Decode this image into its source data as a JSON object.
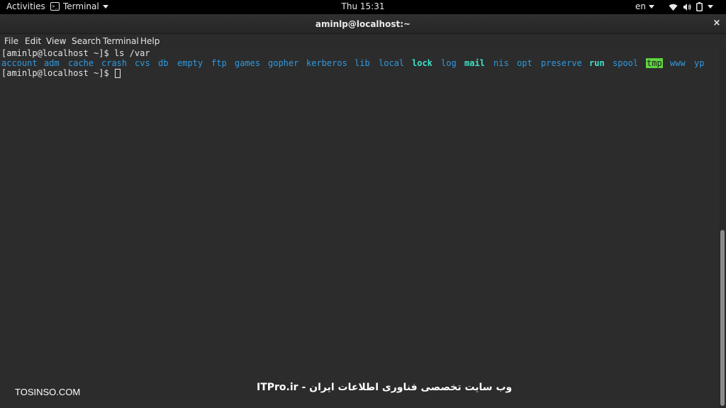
{
  "topbar": {
    "activities": "Activities",
    "app_menu": "Terminal",
    "clock": "Thu 15:31",
    "language": "en"
  },
  "window": {
    "title": "aminlp@localhost:~",
    "close_glyph": "×"
  },
  "menubar": {
    "items": [
      "File",
      "Edit",
      "View",
      "Search",
      "Terminal",
      "Help"
    ]
  },
  "terminal": {
    "prompt": "[aminlp@localhost ~]$ ",
    "command": "ls /var",
    "listing": [
      {
        "name": "account",
        "style": "dir"
      },
      {
        "name": "adm",
        "style": "dir"
      },
      {
        "name": "cache",
        "style": "dir"
      },
      {
        "name": "crash",
        "style": "dir"
      },
      {
        "name": "cvs",
        "style": "dir"
      },
      {
        "name": "db",
        "style": "dir"
      },
      {
        "name": "empty",
        "style": "dir"
      },
      {
        "name": "ftp",
        "style": "dir"
      },
      {
        "name": "games",
        "style": "dir"
      },
      {
        "name": "gopher",
        "style": "dir"
      },
      {
        "name": "kerberos",
        "style": "dir"
      },
      {
        "name": "lib",
        "style": "dir"
      },
      {
        "name": "local",
        "style": "dir"
      },
      {
        "name": "lock",
        "style": "link"
      },
      {
        "name": "log",
        "style": "dir"
      },
      {
        "name": "mail",
        "style": "link"
      },
      {
        "name": "nis",
        "style": "dir"
      },
      {
        "name": "opt",
        "style": "dir"
      },
      {
        "name": "preserve",
        "style": "dir"
      },
      {
        "name": "run",
        "style": "link"
      },
      {
        "name": "spool",
        "style": "dir"
      },
      {
        "name": "tmp",
        "style": "sticky"
      },
      {
        "name": "www",
        "style": "dir"
      },
      {
        "name": "yp",
        "style": "dir"
      }
    ],
    "prompt2": "[aminlp@localhost ~]$ "
  },
  "watermarks": {
    "left": "TOSINSO.COM",
    "center": "ITPro.ir - وب سایت تخصصی فناوری اطلاعات ایران"
  },
  "colors": {
    "terminal_bg": "#2c2c2c",
    "dir": "#2f9ae0",
    "link": "#3de2c8",
    "sticky_bg": "#5dd53f"
  },
  "icons": [
    "terminal-app-icon",
    "wifi-icon",
    "volume-icon",
    "battery-icon",
    "chevron-down-icon",
    "close-icon"
  ]
}
